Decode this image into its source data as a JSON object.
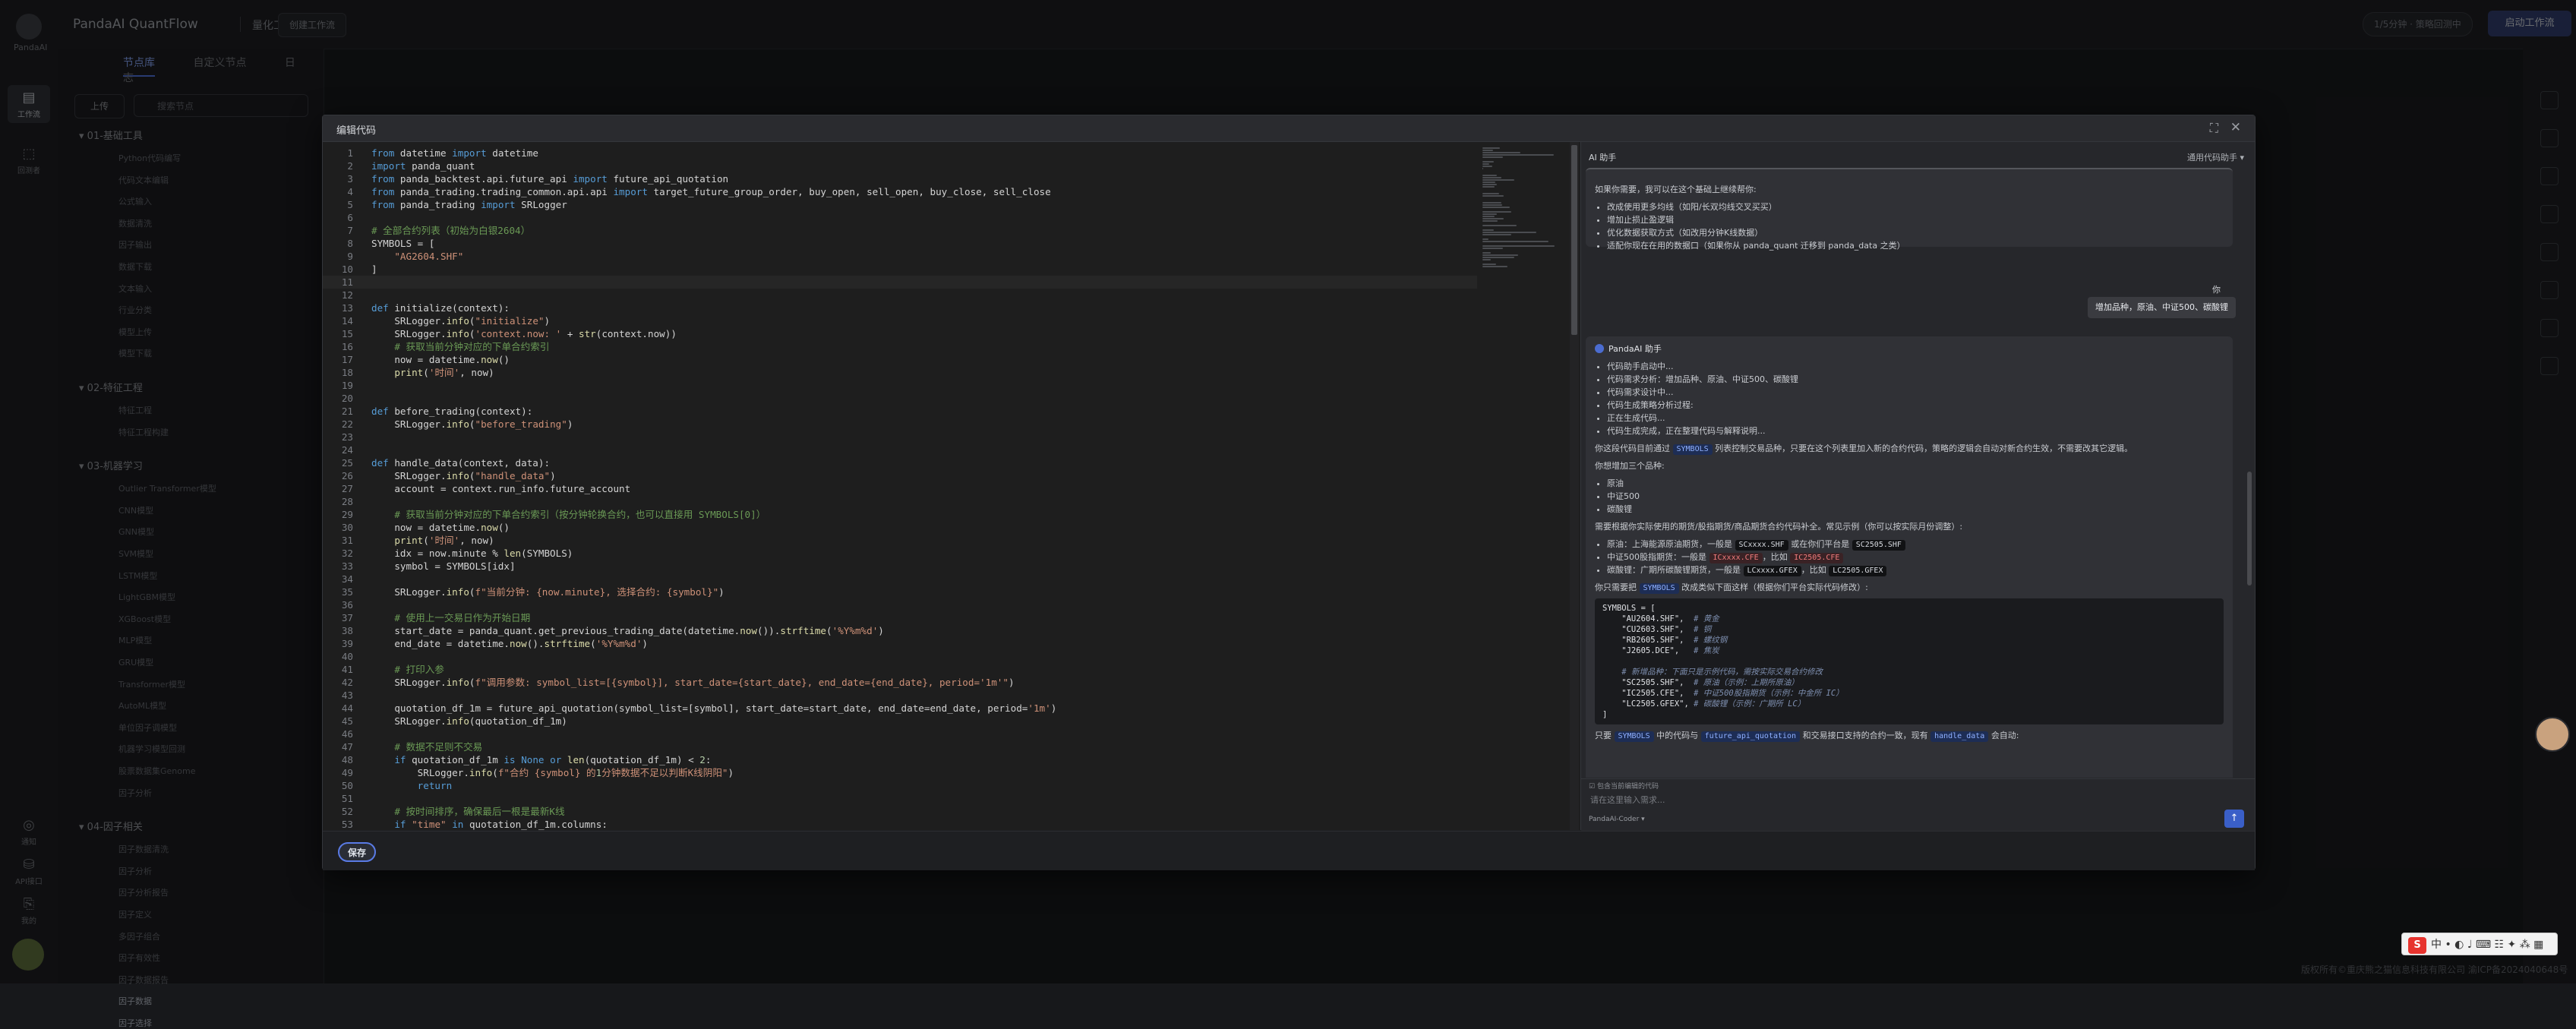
{
  "app": {
    "logo_text": "PandaAI",
    "title": "PandaAI QuantFlow",
    "subtitle": "量化工作流",
    "create_workspace": "创建工作流",
    "queue_status": "1/5分钟 · 策略回测中",
    "run_button": "启动工作流",
    "footer": "版权所有©重庆熊之猫信息科技有限公司 渝ICP备2024040648号"
  },
  "rail": {
    "items": [
      {
        "label": "工作流",
        "icon": "▤"
      },
      {
        "label": "回测者",
        "icon": "⬚"
      },
      {
        "label": "通知",
        "icon": "◎"
      },
      {
        "label": "API接口",
        "icon": "⛁"
      },
      {
        "label": "我的",
        "icon": "⎘"
      }
    ]
  },
  "leftpanel": {
    "tabs": [
      "节点库",
      "自定义节点",
      "日志"
    ],
    "upload": "上传",
    "search_placeholder": "搜索节点",
    "groups": [
      {
        "label": "01-基础工具",
        "items": [
          "Python代码编写",
          "代码文本编辑",
          "公式输入",
          "数据清洗",
          "因子输出",
          "数据下载",
          "文本输入",
          "行业分类",
          "模型上传",
          "模型下载"
        ]
      },
      {
        "label": "02-特征工程",
        "items": [
          "特征工程",
          "特征工程构建"
        ]
      },
      {
        "label": "03-机器学习",
        "items": [
          "Outlier Transformer模型",
          "CNN模型",
          "GNN模型",
          "SVM模型",
          "LSTM模型",
          "LightGBM模型",
          "XGBoost模型",
          "MLP模型",
          "GRU模型",
          "Transformer模型",
          "AutoML模型",
          "单位因子调模型",
          "机器学习模型回测",
          "股票数据集Genome",
          "因子分析"
        ]
      },
      {
        "label": "04-因子相关",
        "items": [
          "因子数据清洗",
          "因子分析",
          "因子分析报告",
          "因子定义",
          "多因子组合",
          "因子有效性",
          "因子数据报告",
          "因子数据",
          "因子选择"
        ]
      }
    ]
  },
  "modal": {
    "title": "编辑代码",
    "save": "保存",
    "code_lines": [
      "from datetime import datetime",
      "import panda_quant",
      "from panda_backtest.api.future_api import future_api_quotation",
      "from panda_trading.trading_common.api.api import target_future_group_order, buy_open, sell_open, buy_close, sell_close",
      "from panda_trading import SRLogger",
      "",
      "# 全部合约列表（初始为白银2604）",
      "SYMBOLS = [",
      "    \"AG2604.SHF\"",
      "]",
      "",
      "",
      "def initialize(context):",
      "    SRLogger.info(\"initialize\")",
      "    SRLogger.info('context.now: ' + str(context.now))",
      "    # 获取当前分钟对应的下单合约索引",
      "    now = datetime.now()",
      "    print('时间', now)",
      "",
      "",
      "def before_trading(context):",
      "    SRLogger.info(\"before_trading\")",
      "",
      "",
      "def handle_data(context, data):",
      "    SRLogger.info(\"handle_data\")",
      "    account = context.run_info.future_account",
      "",
      "    # 获取当前分钟对应的下单合约索引（按分钟轮换合约，也可以直接用 SYMBOLS[0]）",
      "    now = datetime.now()",
      "    print('时间', now)",
      "    idx = now.minute % len(SYMBOLS)",
      "    symbol = SYMBOLS[idx]",
      "",
      "    SRLogger.info(f\"当前分钟: {now.minute}, 选择合约: {symbol}\")",
      "",
      "    # 使用上一交易日作为开始日期",
      "    start_date = panda_quant.get_previous_trading_date(datetime.now()).strftime('%Y%m%d')",
      "    end_date = datetime.now().strftime('%Y%m%d')",
      "",
      "    # 打印入参",
      "    SRLogger.info(f\"调用参数: symbol_list=[{symbol}], start_date={start_date}, end_date={end_date}, period='1m'\")",
      "",
      "    quotation_df_1m = future_api_quotation(symbol_list=[symbol], start_date=start_date, end_date=end_date, period='1m')",
      "    SRLogger.info(quotation_df_1m)",
      "",
      "    # 数据不足则不交易",
      "    if quotation_df_1m is None or len(quotation_df_1m) < 2:",
      "        SRLogger.info(f\"合约 {symbol} 的1分钟数据不足以判断K线阴阳\")",
      "        return",
      "",
      "    # 按时间排序，确保最后一根是最新K线",
      "    if \"time\" in quotation_df_1m.columns:"
    ]
  },
  "assistant": {
    "title": "AI 助手",
    "mode": "通用代码助手",
    "msg1_intro": "如果你需要，我可以在这个基础上继续帮你:",
    "msg1_list": [
      "改成使用更多均线（如阳/长双均线交叉买买）",
      "增加止损止盈逻辑",
      "优化数据获取方式（如改用分钟K线数据）",
      "适配你现在在用的数据口（如果你从 panda_quant 迁移到 panda_data 之类）"
    ],
    "user_label": "你",
    "user_text": "增加品种，原油、中证500、碳酸锂",
    "ai_name": "PandaAI 助手",
    "msg2_status": [
      "代码助手启动中...",
      "代码需求分析：增加品种、原油、中证500、碳酸锂",
      "代码需求设计中...",
      "代码生成策略分析过程:",
      "正在生成代码...",
      "代码生成完成，正在整理代码与解释说明..."
    ],
    "msg2_p1a": "你这段代码目前通过",
    "msg2_p1_pill": "SYMBOLS",
    "msg2_p1b": "列表控制交易品种，只要在这个列表里加入新的合约代码，策略的逻辑会自动对新合约生效，不需要改其它逻辑。",
    "msg2_p2": "你想增加三个品种:",
    "msg2_list2": [
      "原油",
      "中证500",
      "碳酸锂"
    ],
    "msg2_p3": "需要根据你实际使用的期货/股指期货/商品期货合约代码补全。常见示例（你可以按实际月份调整）:",
    "msg2_c1a": "原油：上海能源原油期货，一般是",
    "msg2_c1p": "SCxxxx.SHF",
    "msg2_c1b": "或在你们平台是",
    "msg2_c1p2": "SC2505.SHF",
    "msg2_c2a": "中证500股指期货：一般是",
    "msg2_c2p": "ICxxxx.CFE",
    "msg2_c2b": "，比如",
    "msg2_c2p2": "IC2505.CFE",
    "msg2_c3a": "碳酸锂：广期所碳酸锂期货，一般是",
    "msg2_c3p": "LCxxxx.GFEX",
    "msg2_c3b": "，比如",
    "msg2_c3p2": "LC2505.GFEX",
    "msg2_p4a": "你只需要把",
    "msg2_p4_pill": "SYMBOLS",
    "msg2_p4b": "改成类似下面这样（根据你们平台实际代码修改）:",
    "codeblock": [
      {
        "code": "SYMBOLS = [",
        "comment": ""
      },
      {
        "code": "    \"AU2604.SHF\",",
        "comment": "  # 黄金"
      },
      {
        "code": "    \"CU2603.SHF\",",
        "comment": "  # 铜"
      },
      {
        "code": "    \"RB2605.SHF\",",
        "comment": "  # 螺纹钢"
      },
      {
        "code": "    \"J2605.DCE\",",
        "comment": "   # 焦炭"
      },
      {
        "code": "",
        "comment": ""
      },
      {
        "code": "    ",
        "comment": "# 新增品种：下面只是示例代码，需按实际交易合约修改"
      },
      {
        "code": "    \"SC2505.SHF\",",
        "comment": "  # 原油（示例：上期所原油）"
      },
      {
        "code": "    \"IC2505.CFE\",",
        "comment": "  # 中证500股指期货（示例：中金所 IC）"
      },
      {
        "code": "    \"LC2505.GFEX\",",
        "comment": " # 碳酸锂（示例：广期所 LC）"
      },
      {
        "code": "]",
        "comment": ""
      }
    ],
    "msg2_p5a": "只要",
    "msg2_p5_pill1": "SYMBOLS",
    "msg2_p5b": "中的代码与",
    "msg2_p5_pill2": "future_api_quotation",
    "msg2_p5c": "和交易接口支持的合约一致，现有",
    "msg2_p5_pill3": "handle_data",
    "msg2_p5d": "会自动:",
    "ctx_label": "包含当前编辑的代码",
    "input_placeholder": "请在这里输入需求...",
    "model": "PandaAI-Coder"
  }
}
